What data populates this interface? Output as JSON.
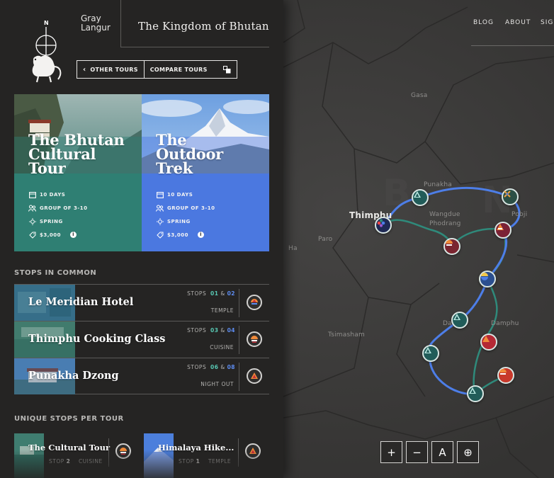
{
  "brand": {
    "line1": "Gray",
    "line2": "Langur",
    "compass_letter": "N"
  },
  "page_title": "The Kingdom of Bhutan",
  "top_nav": [
    "BLOG",
    "ABOUT",
    "SIGN"
  ],
  "buttons": {
    "other_tours": "OTHER TOURS",
    "compare_tours": "COMPARE TOURS"
  },
  "tours": [
    {
      "title_line1": "The Bhutan",
      "title_line2": "Cultural",
      "title_line3": "Tour",
      "duration": "10 DAYS",
      "group": "GROUP OF 3-10",
      "season": "SPRING",
      "price": "$3,000",
      "color": "#2f7f73"
    },
    {
      "title_line1": "The",
      "title_line2": "Outdoor",
      "title_line3": "Trek",
      "duration": "10 DAYS",
      "group": "GROUP OF 3-10",
      "season": "SPRING",
      "price": "$3,000",
      "color": "#4b78e0"
    }
  ],
  "stops_in_common": {
    "heading": "STOPS IN COMMON",
    "stops_label": "STOPS",
    "amp": "&",
    "items": [
      {
        "name": "Le Meridian Hotel",
        "stop_a": "01",
        "stop_b": "02",
        "category": "TEMPLE",
        "icon": "temple-icon"
      },
      {
        "name": "Thimphu Cooking Class",
        "stop_a": "03",
        "stop_b": "04",
        "category": "CUISINE",
        "icon": "cuisine-icon"
      },
      {
        "name": "Punakha Dzong",
        "stop_a": "06",
        "stop_b": "08",
        "category": "NIGHT OUT",
        "icon": "night-out-icon"
      }
    ]
  },
  "unique_stops": {
    "heading": "UNIQUE STOPS PER TOUR",
    "items": [
      {
        "name": "The Cultural Tour",
        "stop_label": "STOP",
        "stop_num": "2",
        "category": "CUISINE",
        "icon": "cuisine-icon"
      },
      {
        "name": "Himalaya Hike...",
        "stop_label": "STOP",
        "stop_num": "1",
        "category": "TEMPLE",
        "icon": "temple-icon"
      }
    ]
  },
  "map": {
    "labels": {
      "gasa": "Gasa",
      "punakha": "Punakha",
      "thimphu": "Thimphu",
      "wangdue1": "Wangdue",
      "wangdue2": "Phodrang",
      "paro": "Paro",
      "ha": "Ha",
      "pobji": "Pobji",
      "tsimasham": "Tsimasham",
      "dagana": "Da",
      "damphu": "Damphu"
    },
    "controls": {
      "zoom_in": "+",
      "zoom_out": "−",
      "text": "A",
      "locate": "⊕"
    },
    "route_colors": {
      "trek": "#4d7ee8",
      "cultural": "#2f8a7b"
    }
  }
}
